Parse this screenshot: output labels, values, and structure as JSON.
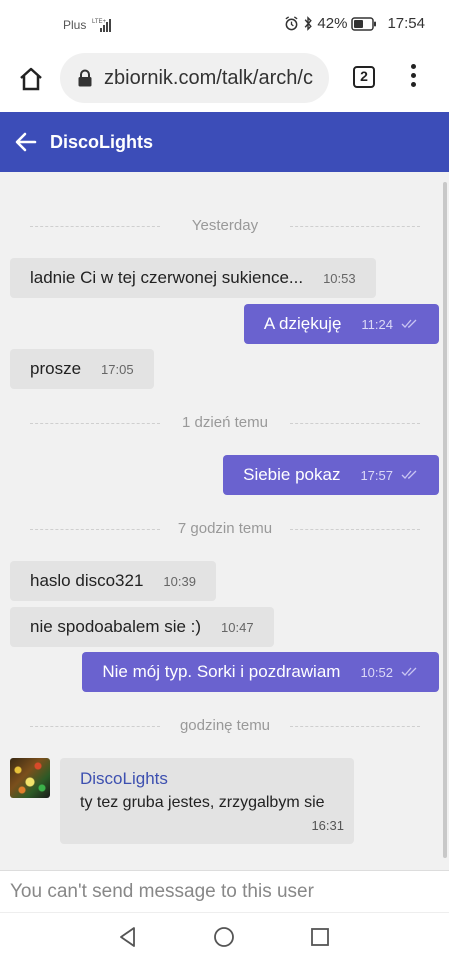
{
  "status_bar": {
    "carrier": "Plus",
    "network": "LTE+",
    "battery": "42%",
    "time": "17:54"
  },
  "browser": {
    "url": "zbiornik.com/talk/arch/c",
    "tab_count": "2",
    "icons": [
      "home-icon",
      "lock-icon",
      "tabs-icon",
      "more-vert-icon"
    ]
  },
  "header": {
    "title": "DiscoLights",
    "back_icon": "arrow-back-icon"
  },
  "chat": {
    "dividers": [
      "Yesterday",
      "1 dzień temu",
      "7 godzin temu",
      "godzinę temu"
    ],
    "messages": [
      {
        "dir": "in",
        "text": "ladnie Ci w tej czerwonej sukience...",
        "time": "10:53"
      },
      {
        "dir": "out",
        "text": "A dziękuję",
        "time": "11:24"
      },
      {
        "dir": "in",
        "text": "prosze",
        "time": "17:05"
      },
      {
        "dir": "out",
        "text": "Siebie pokaz",
        "time": "17:57"
      },
      {
        "dir": "in",
        "text": "haslo disco321",
        "time": "10:39"
      },
      {
        "dir": "in",
        "text": "nie spodoabalem sie :)",
        "time": "10:47"
      },
      {
        "dir": "out",
        "text": "Nie mój typ. Sorki i pozdrawiam",
        "time": "10:52"
      }
    ],
    "last": {
      "author": "DiscoLights",
      "text": "ty tez gruba jestes, zrzygalbym sie",
      "time": "16:31"
    }
  },
  "composer": {
    "placeholder": "You can't send message to this user"
  },
  "colors": {
    "header": "#3c4db8",
    "outgoing": "#6a62cf",
    "incoming": "#e3e3e3",
    "author": "#3d50b0"
  }
}
